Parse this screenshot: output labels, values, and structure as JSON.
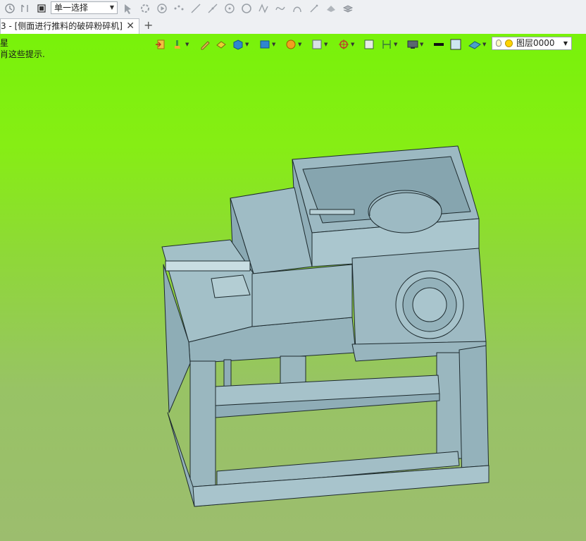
{
  "toolbar": {
    "select_mode": "单一选择",
    "icons": [
      "rotate-view-icon",
      "undo-icon",
      "stop-icon",
      "pick-arrow-icon",
      "pick-filter-icon",
      "play-icon",
      "point-icon",
      "line-icon",
      "line2-icon",
      "circle-point-icon",
      "circle-icon",
      "curve-icon",
      "arc-icon",
      "spline-icon",
      "pen-icon",
      "shape-icon",
      "layers-icon"
    ]
  },
  "tab": {
    "title": "3 - [侧面进行推料的破碎粉碎机]",
    "close": "✕",
    "new": "+"
  },
  "hints": {
    "line1": "星",
    "line2": "肖这些提示."
  },
  "view_toolbar": {
    "icons": [
      "exit-icon",
      "paint-brush-icon",
      "pencil-icon",
      "fill-icon",
      "cube-icon",
      "display-mode-icon",
      "render-icon",
      "view-icon",
      "orient-icon",
      "frame-icon",
      "dimension-icon",
      "monitor-icon",
      "line-color-icon",
      "face-color-icon",
      "plane-icon"
    ],
    "layer": "图层0000"
  },
  "colors": {
    "background_top": "#78f20a",
    "background_bottom": "#9cbd6e",
    "model": "#a8c4cc",
    "edge": "#1d2a2e"
  }
}
